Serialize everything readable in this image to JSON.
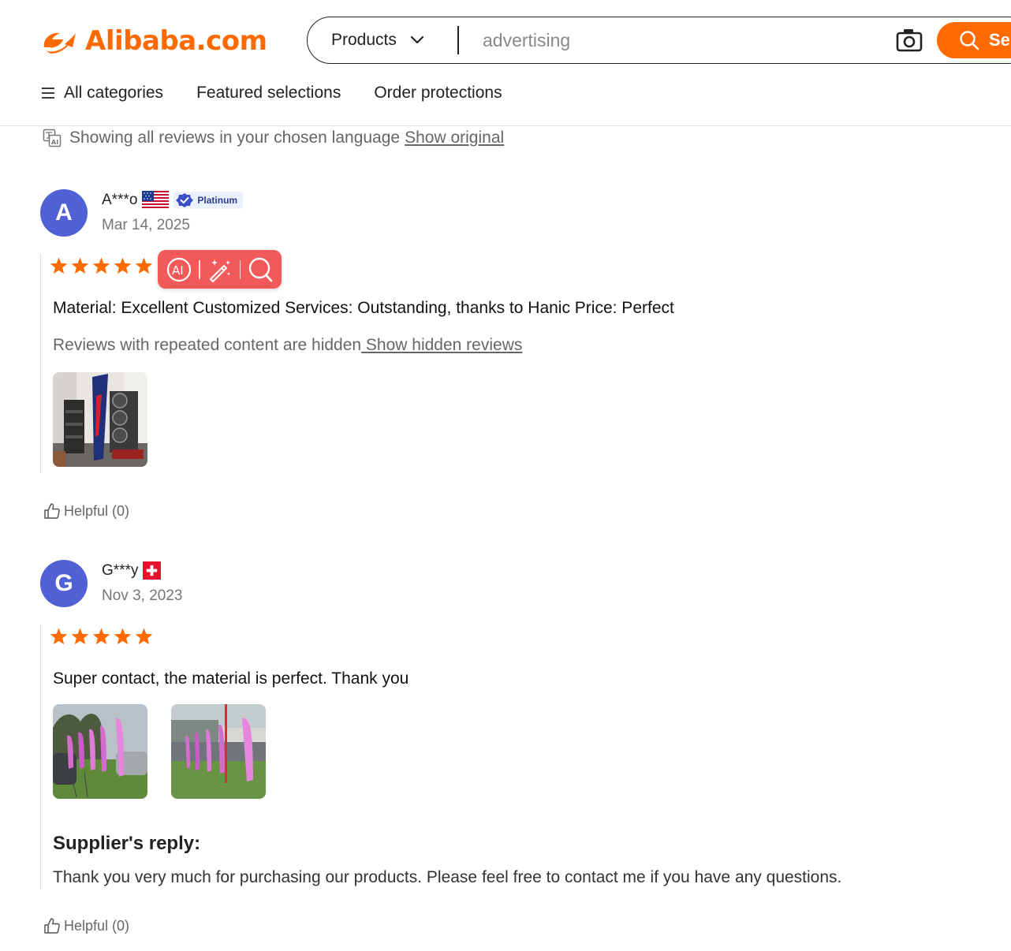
{
  "header": {
    "logo_text": "Alibaba.com",
    "search": {
      "category": "Products",
      "query": "advertising",
      "button_label": "Se"
    },
    "nav": {
      "all_categories": "All categories",
      "featured": "Featured selections",
      "order_protections": "Order protections"
    }
  },
  "translation_note": {
    "text": "Showing all reviews in your chosen language",
    "link": "Show original"
  },
  "reviews": [
    {
      "initial": "A",
      "name": "A***o",
      "country": "United States",
      "badge": "Platinum",
      "date": "Mar 14, 2025",
      "rating": 5,
      "text": "Material: Excellent Customized Services: Outstanding, thanks to Hanic Price: Perfect",
      "hidden_note": "Reviews with repeated content are hidden",
      "hidden_link": " Show hidden reviews",
      "helpful": "Helpful (0)"
    },
    {
      "initial": "G",
      "name": "G***y",
      "country": "Switzerland",
      "date": "Nov 3, 2023",
      "rating": 5,
      "text": "Super contact, the material is perfect. Thank you",
      "supplier_reply_title": "Supplier's reply:",
      "supplier_reply": "Thank you very much for purchasing our products. Please feel free to contact me if you have any questions.",
      "helpful": "Helpful (0)"
    }
  ],
  "colors": {
    "brand": "#ff6a00",
    "star": "#ff6a00",
    "avatar": "#5061d6",
    "ai_toolbar": "#f25a5a"
  },
  "icons": [
    "alibaba-logo-icon",
    "chevron-down-icon",
    "camera-icon",
    "search-icon",
    "menu-icon",
    "translate-icon",
    "verified-badge-icon",
    "star-icon",
    "ai-icon",
    "magic-wand-icon",
    "magnifier-icon",
    "thumbs-up-icon"
  ]
}
